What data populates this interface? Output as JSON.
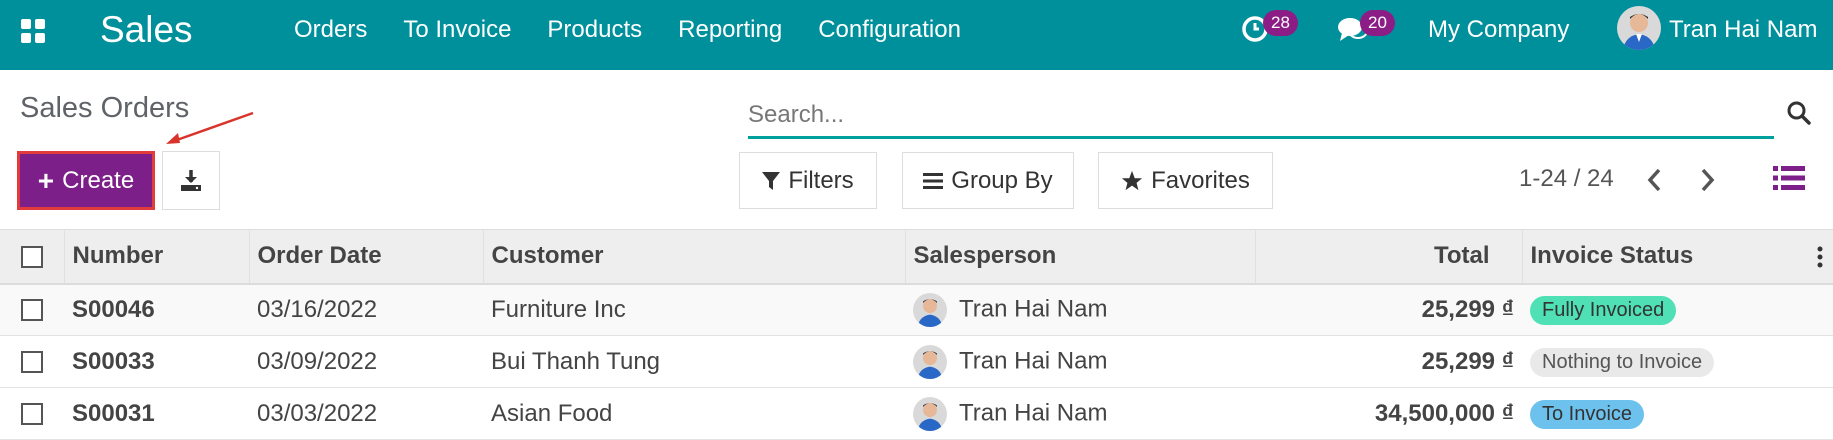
{
  "navbar": {
    "brand": "Sales",
    "menu": [
      "Orders",
      "To Invoice",
      "Products",
      "Reporting",
      "Configuration"
    ],
    "activity_count": "28",
    "message_count": "20",
    "company": "My Company",
    "user_name": "Tran Hai Nam"
  },
  "control_panel": {
    "title": "Sales Orders",
    "create_label": "Create",
    "search_placeholder": "Search...",
    "filters_label": "Filters",
    "group_by_label": "Group By",
    "favorites_label": "Favorites",
    "pager": "1-24 / 24"
  },
  "table": {
    "columns": [
      "Number",
      "Order Date",
      "Customer",
      "Salesperson",
      "Total",
      "Invoice Status"
    ],
    "rows": [
      {
        "number": "S00046",
        "date": "03/16/2022",
        "customer": "Furniture Inc",
        "salesperson": "Tran Hai Nam",
        "total": "25,299 ₫",
        "status": "Fully Invoiced"
      },
      {
        "number": "S00033",
        "date": "03/09/2022",
        "customer": "Bui Thanh Tung",
        "salesperson": "Tran Hai Nam",
        "total": "25,299 ₫",
        "status": "Nothing to Invoice"
      },
      {
        "number": "S00031",
        "date": "03/03/2022",
        "customer": "Asian Food",
        "salesperson": "Tran Hai Nam",
        "total": "34,500,000 ₫",
        "status": "To Invoice"
      }
    ]
  },
  "colors": {
    "navbar": "#00909c",
    "primary": "#7c1f89",
    "badge": "#8c1d86",
    "status_fully_invoiced": "#4fe0b5",
    "status_nothing": "#e9e9e9",
    "status_to_invoice": "#6cc1ed",
    "annotation": "#d9342b"
  }
}
